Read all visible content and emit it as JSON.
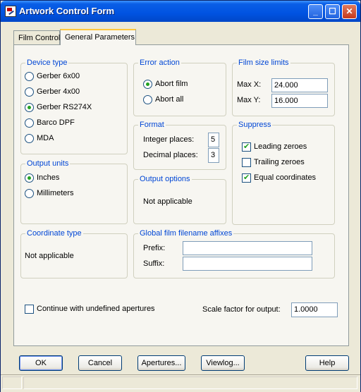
{
  "window": {
    "title": "Artwork Control Form"
  },
  "tabs": [
    {
      "label": "Film Control"
    },
    {
      "label": "General Parameters"
    }
  ],
  "device_type": {
    "title": "Device type",
    "options": [
      "Gerber 6x00",
      "Gerber 4x00",
      "Gerber RS274X",
      "Barco DPF",
      "MDA"
    ],
    "selected": "Gerber RS274X"
  },
  "error_action": {
    "title": "Error action",
    "options": [
      "Abort film",
      "Abort all"
    ],
    "selected": "Abort film"
  },
  "film_size": {
    "title": "Film size limits",
    "max_x_label": "Max X:",
    "max_x_value": "24.000",
    "max_y_label": "Max Y:",
    "max_y_value": "16.000"
  },
  "format": {
    "title": "Format",
    "integer_label": "Integer places:",
    "integer_value": "5",
    "decimal_label": "Decimal places:",
    "decimal_value": "3"
  },
  "suppress": {
    "title": "Suppress",
    "leading": {
      "label": "Leading zeroes",
      "checked": true
    },
    "trailing": {
      "label": "Trailing zeroes",
      "checked": false
    },
    "equal": {
      "label": "Equal coordinates",
      "checked": true
    }
  },
  "output_units": {
    "title": "Output units",
    "options": [
      "Inches",
      "Millimeters"
    ],
    "selected": "Inches"
  },
  "output_options": {
    "title": "Output options",
    "text": "Not applicable"
  },
  "coordinate_type": {
    "title": "Coordinate type",
    "text": "Not applicable"
  },
  "affixes": {
    "title": "Global film filename affixes",
    "prefix_label": "Prefix:",
    "prefix_value": "",
    "suffix_label": "Suffix:",
    "suffix_value": ""
  },
  "continue_undefined": {
    "label": "Continue with undefined apertures",
    "checked": false
  },
  "scale": {
    "label": "Scale factor for output:",
    "value": "1.0000"
  },
  "buttons": {
    "ok": "OK",
    "cancel": "Cancel",
    "apertures": "Apertures...",
    "viewlog": "Viewlog...",
    "help": "Help"
  }
}
